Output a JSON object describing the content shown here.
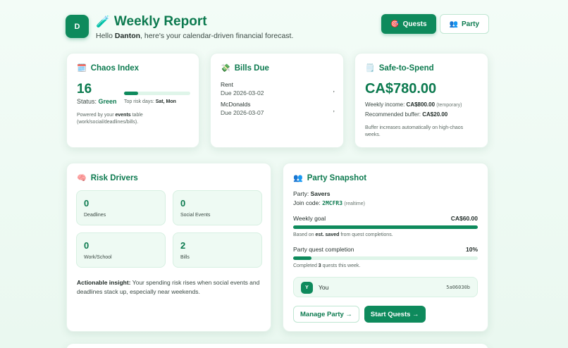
{
  "header": {
    "avatar_initial": "D",
    "title_emoji": "🧪",
    "title": "Weekly Report",
    "greeting_prefix": "Hello ",
    "user_name": "Danton",
    "greeting_suffix": ", here's your calendar-driven financial forecast.",
    "quests_icon": "🎯",
    "quests_label": "Quests",
    "party_icon": "👥",
    "party_label": "Party"
  },
  "chaos": {
    "icon": "🗓️",
    "title": "Chaos Index",
    "value": "16",
    "status_label": "Status: ",
    "status_value": "Green",
    "fill_percent": 21,
    "risk_label": "Top risk days: ",
    "risk_days": "Sat, Mon",
    "note_prefix": "Powered by your ",
    "note_bold": "events",
    "note_suffix": " table (work/social/deadlines/bills)."
  },
  "bills": {
    "icon": "💸",
    "title": "Bills Due",
    "items": [
      {
        "name": "Rent",
        "due": "Due 2026-03-02",
        "amount": ","
      },
      {
        "name": "McDonalds",
        "due": "Due 2026-03-07",
        "amount": ","
      }
    ]
  },
  "safe": {
    "icon": "🗒️",
    "title": "Safe-to-Spend",
    "value": "CA$780.00",
    "income_label": "Weekly income: ",
    "income_value": "CA$800.00",
    "income_note": "(temporary)",
    "buffer_label": "Recommended buffer: ",
    "buffer_value": "CA$20.00",
    "note": "Buffer increases automatically on high-chaos weeks."
  },
  "risk": {
    "icon": "🧠",
    "title": "Risk Drivers",
    "tiles": [
      {
        "value": "0",
        "label": "Deadlines"
      },
      {
        "value": "0",
        "label": "Social Events"
      },
      {
        "value": "0",
        "label": "Work/School"
      },
      {
        "value": "2",
        "label": "Bills"
      }
    ],
    "insight_bold": "Actionable insight:",
    "insight_text": " Your spending risk rises when social events and deadlines stack up, especially near weekends."
  },
  "party": {
    "icon": "👥",
    "title": "Party Snapshot",
    "party_label": "Party: ",
    "party_name": "Savers",
    "join_label": "Join code: ",
    "join_code": "2MCFR3",
    "join_note": "(realtime)",
    "goal_label": "Weekly goal",
    "goal_value": "CA$60.00",
    "goal_fill_percent": 100,
    "goal_note_prefix": "Based on ",
    "goal_note_bold": "est. saved",
    "goal_note_suffix": " from quest completions.",
    "completion_label": "Party quest completion",
    "completion_value": "10%",
    "completion_fill_percent": 10,
    "completion_note_prefix": "Completed ",
    "completion_note_bold": "3",
    "completion_note_suffix": " quests this week.",
    "member_initial": "Y",
    "member_name": "You",
    "member_id": "5a06030b",
    "manage_label": "Manage Party →",
    "start_label": "Start Quests →"
  }
}
